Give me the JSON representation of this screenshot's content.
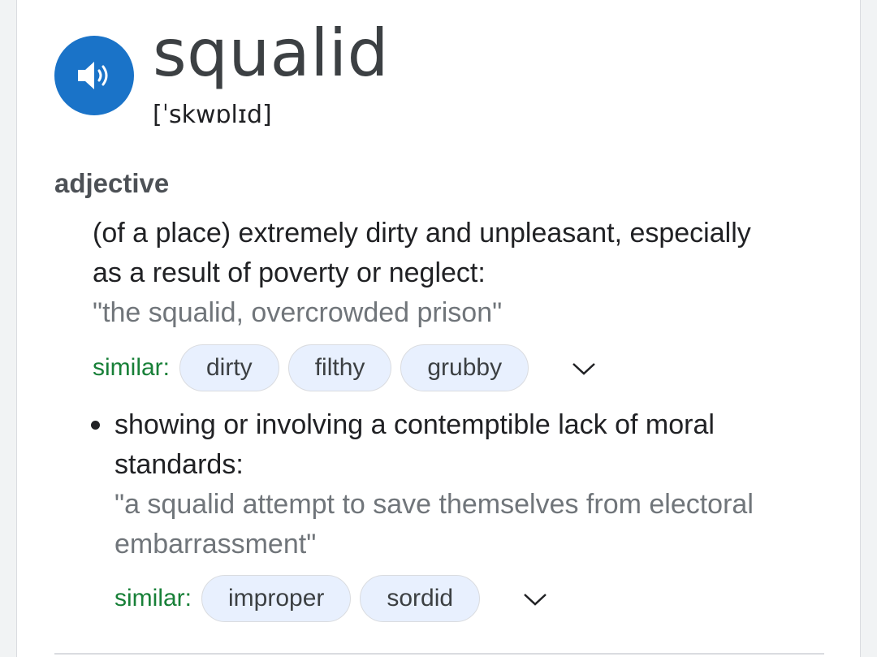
{
  "entry": {
    "word": "squalid",
    "phonetic": "[ˈskwɒlɪd]",
    "part_of_speech": "adjective"
  },
  "senses": [
    {
      "definition_line1": "(of a place) extremely dirty and unpleasant, especially",
      "definition_line2": "as a result of poverty or neglect:",
      "example": "\"the squalid, overcrowded prison\"",
      "similar_label": "similar:",
      "similar": [
        "dirty",
        "filthy",
        "grubby"
      ]
    },
    {
      "definition_line1": "showing or involving a contemptible lack of moral",
      "definition_line2": "standards:",
      "example_line1": "\"a squalid attempt to save themselves from electoral",
      "example_line2": "embarrassment\"",
      "similar_label": "similar:",
      "similar": [
        "improper",
        "sordid"
      ]
    }
  ],
  "icons": {
    "speaker": "volume-icon",
    "expand": "chevron-down-icon"
  },
  "colors": {
    "speaker_bg": "#1a73c8",
    "similar_label": "#188038",
    "chip_bg": "#e8f0fe",
    "example_text": "#70757a"
  }
}
